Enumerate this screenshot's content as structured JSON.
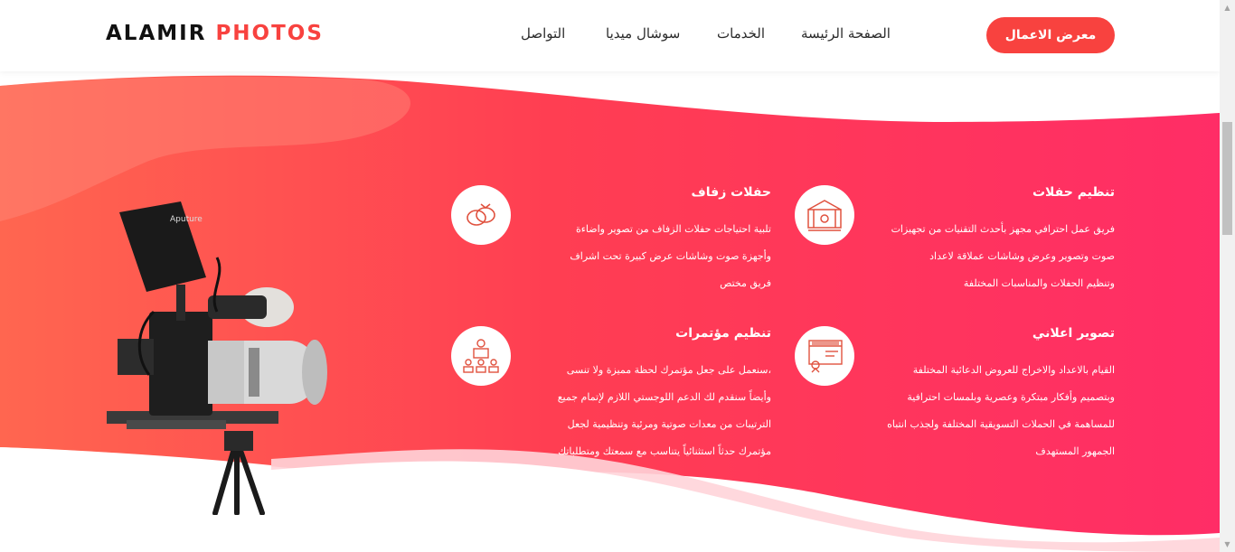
{
  "header": {
    "logo_main": "ALAMIR",
    "logo_accent": "PHOTOS",
    "nav": [
      {
        "label": "الصفحة الرئيسة"
      },
      {
        "label": "الخدمات"
      },
      {
        "label": "سوشال ميديا"
      },
      {
        "label": "التواصل"
      }
    ],
    "cta_label": "معرض الاعمال"
  },
  "services": [
    {
      "title": "تنظيم حفلات",
      "lines": [
        "فريق عمل احترافي مجهز بأحدث التقنيات من تجهيزات",
        "صوت وتصوير وعرض وشاشات عملاقة لاعداد",
        "وتنظيم الحفلات والمناسبات المختلفة"
      ],
      "icon": "stage-icon"
    },
    {
      "title": "حفلات زفاف",
      "lines": [
        "تلبية احتياجات حفلات الزفاف من تصوير واضاءة",
        "وأجهزة صوت وشاشات عرض كبيرة تحت اشراف",
        "فريق مختص"
      ],
      "icon": "rings-icon"
    },
    {
      "title": "تصوير اعلاني",
      "lines": [
        "القيام بالاعداد والاخراج للعروض الدعائية المختلفة",
        "وبتصميم وأفكار مبتكرة وعصرية وبلمسات احترافية",
        "للمساهمة في الحملات التسويقية المختلفة ولجذب انتباه",
        "الجمهور المستهدف"
      ],
      "icon": "advertisement-icon"
    },
    {
      "title": "تنظيم مؤتمرات",
      "lines": [
        "سنعمل على جعل مؤتمرك لحظة مميزة ولا تنسى،",
        "وأيضاً سنقدم لك الدعم اللوجستي اللازم لإتمام جميع",
        "الترتيبات من معدات صوتية ومرئية وتنظيمية لجعل",
        "مؤتمرك حدثاً استثنائياً يتناسب مع سمعتك ومتطلباتك"
      ],
      "icon": "conference-icon"
    }
  ],
  "camera": {
    "brand": "Aputure"
  },
  "colors": {
    "accent": "#f8423f",
    "hero_start": "#ff6a52",
    "hero_end": "#ff2f66"
  }
}
